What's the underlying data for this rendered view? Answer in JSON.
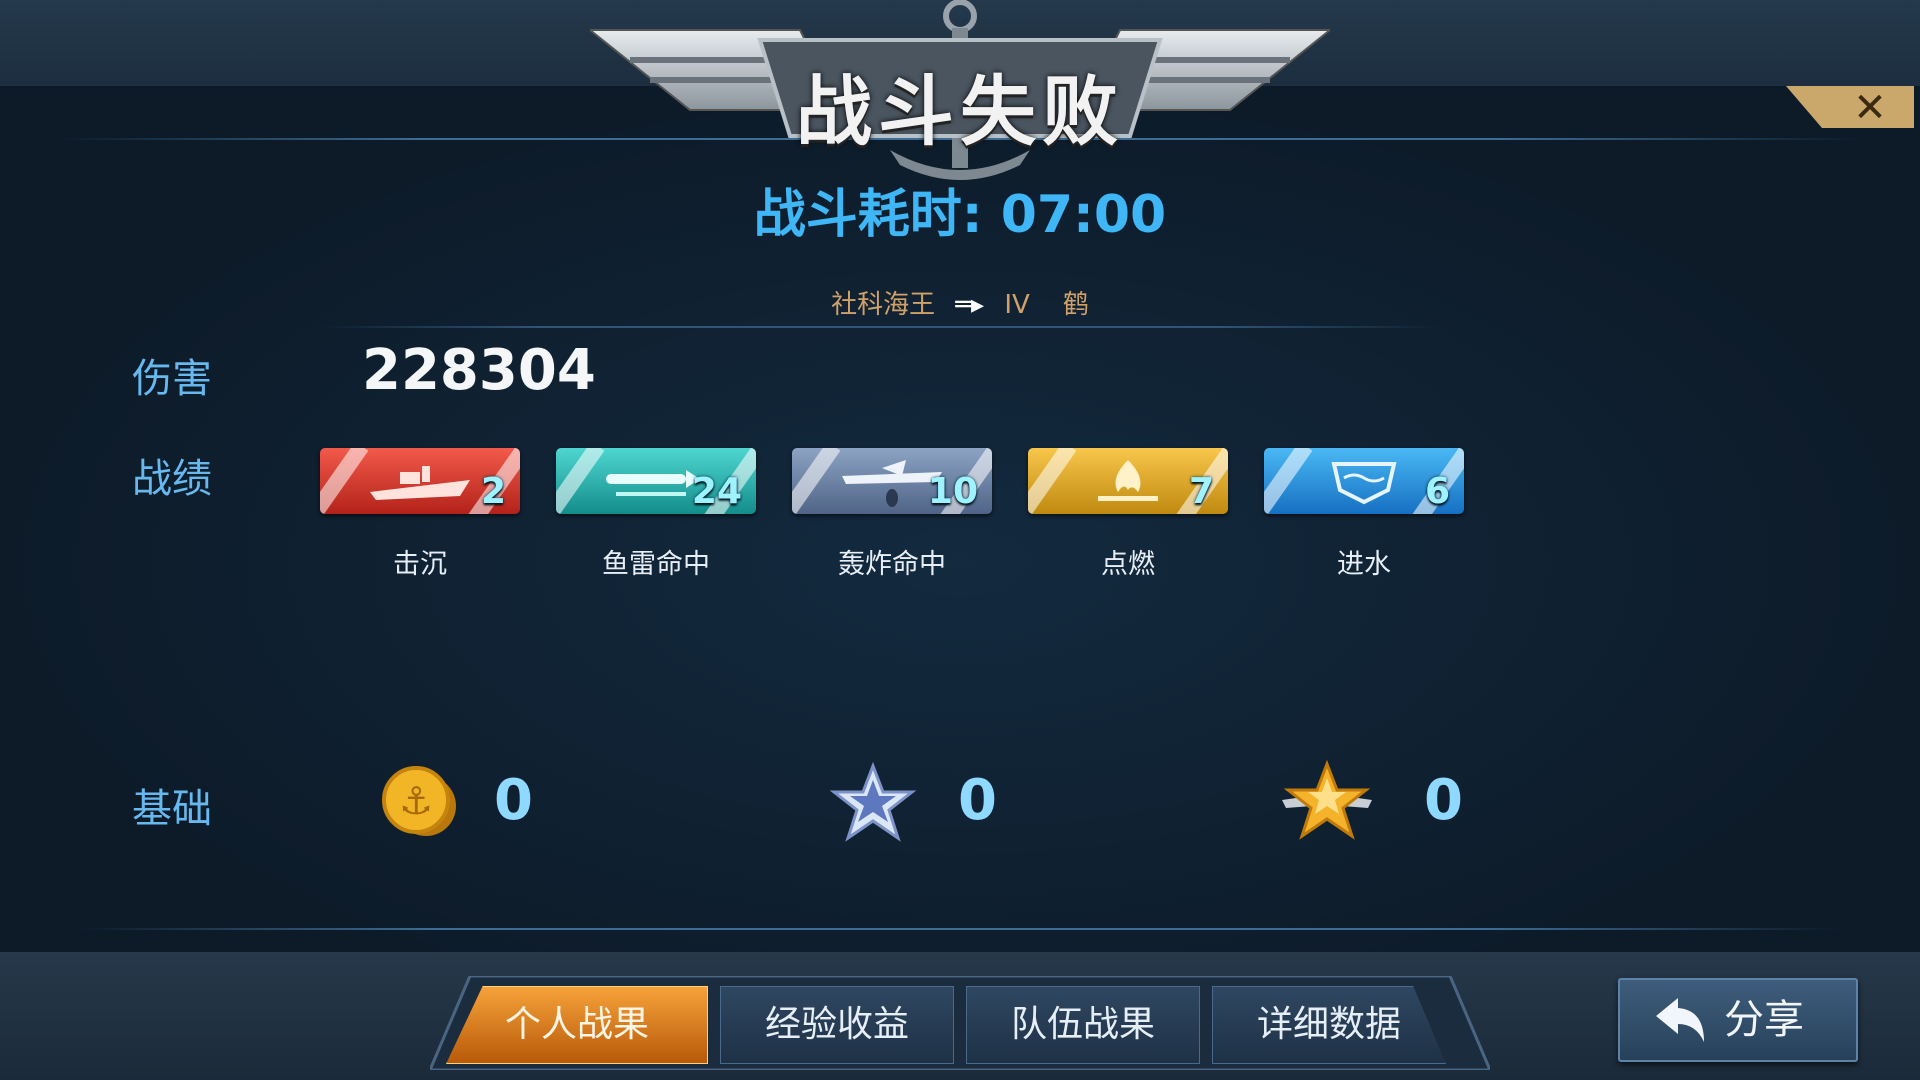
{
  "header": {
    "title": "战斗失败"
  },
  "battle": {
    "time_label": "战斗耗时: ",
    "time_value": "07:00"
  },
  "ship": {
    "from": "社科海王",
    "tier": "IV",
    "name": "鹤"
  },
  "damage": {
    "label": "伤害",
    "value": "228304"
  },
  "achievements": {
    "label": "战绩",
    "items": [
      {
        "name": "击沉",
        "count": "2",
        "color": "#d8322a",
        "icon": "warship-icon"
      },
      {
        "name": "鱼雷命中",
        "count": "24",
        "color": "#1fb3b0",
        "icon": "torpedo-icon"
      },
      {
        "name": "轰炸命中",
        "count": "10",
        "color": "#6b82a8",
        "icon": "bomber-icon"
      },
      {
        "name": "点燃",
        "count": "7",
        "color": "#e0a822",
        "icon": "fire-icon"
      },
      {
        "name": "进水",
        "count": "6",
        "color": "#2a92e0",
        "icon": "flooding-icon"
      }
    ]
  },
  "base": {
    "label": "基础",
    "items": [
      {
        "icon": "anchor-coin-icon",
        "value": "0"
      },
      {
        "icon": "silver-star-icon",
        "value": "0"
      },
      {
        "icon": "winged-gold-star-icon",
        "value": "0"
      }
    ]
  },
  "tabs": [
    {
      "label": "个人战果",
      "active": true
    },
    {
      "label": "经验收益",
      "active": false
    },
    {
      "label": "队伍战果",
      "active": false
    },
    {
      "label": "详细数据",
      "active": false
    }
  ],
  "share": {
    "label": "分享"
  },
  "colors": {
    "accent": "#3fb6f5",
    "active_tab": "#e8861e",
    "ship_text": "#d1a268"
  }
}
